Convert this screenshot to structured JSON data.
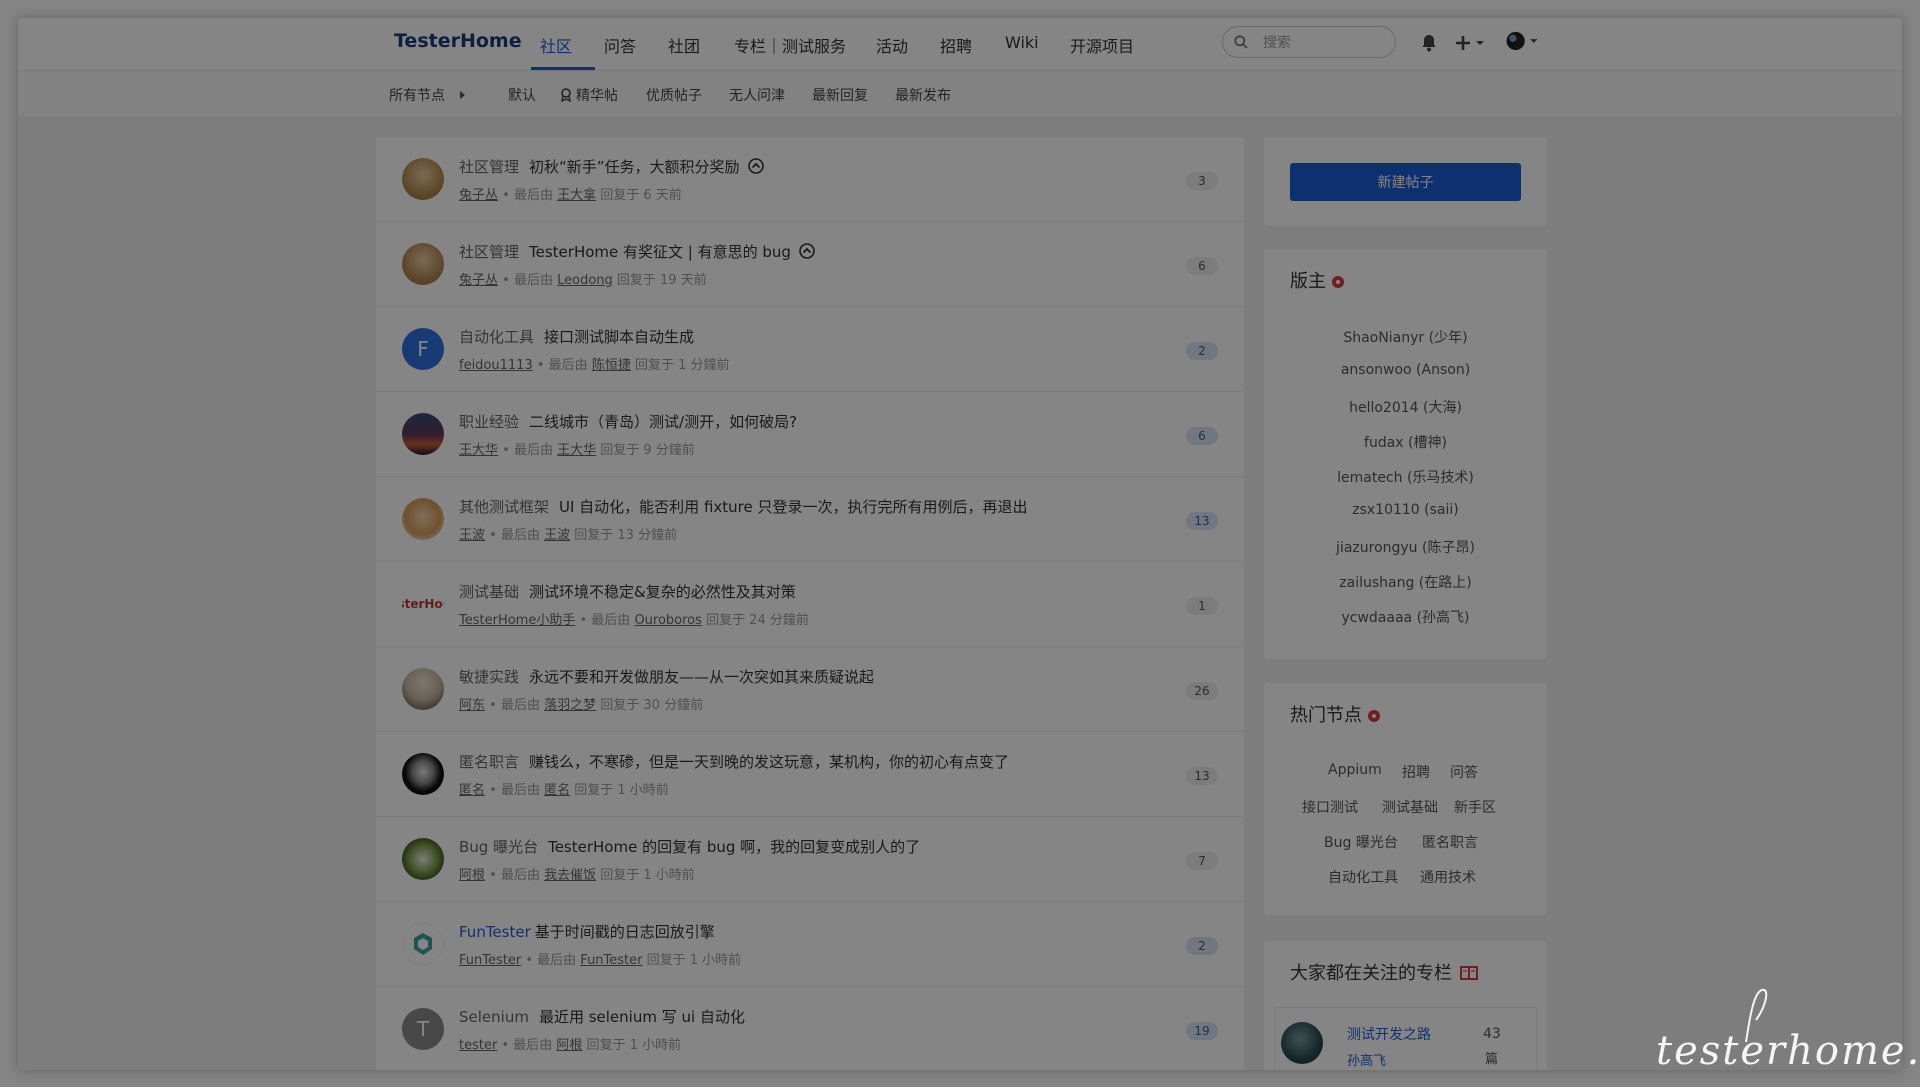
{
  "navbar": {
    "brand": "TesterHome",
    "links": [
      "社区",
      "问答",
      "社团",
      "专栏｜测试服务",
      "活动",
      "招聘",
      "Wiki",
      "开源项目"
    ],
    "search_placeholder": "搜索"
  },
  "subnav": {
    "all_nodes": "所有节点",
    "filters": [
      "默认",
      "精华帖",
      "优质帖子",
      "无人问津",
      "最新回复",
      "最新发布"
    ]
  },
  "topics": [
    {
      "node": "社区管理",
      "title": "初秋“新手”任务，大额积分奖励",
      "author": "兔子丛",
      "last_by_label": "最后由",
      "last_by": "王大拿",
      "time": "回复于 6 天前",
      "replies": "3",
      "pinned": true
    },
    {
      "node": "社区管理",
      "title": "TesterHome 有奖征文 | 有意思的 bug",
      "author": "兔子丛",
      "last_by_label": "最后由",
      "last_by": "Leodong",
      "time": "回复于 19 天前",
      "replies": "6",
      "pinned": true
    },
    {
      "node": "自动化工具",
      "title": "接口测试脚本自动生成",
      "author": "feidou1113",
      "last_by_label": "最后由",
      "last_by": "陈恒捷",
      "time": "回复于 1 分鐘前",
      "replies": "2",
      "avatar_letter": "F"
    },
    {
      "node": "职业经验",
      "title": "二线城市（青岛）测试/测开，如何破局?",
      "author": "王大华",
      "last_by_label": "最后由",
      "last_by": "王大华",
      "time": "回复于 9 分鐘前",
      "replies": "6"
    },
    {
      "node": "其他测试框架",
      "title": "UI 自动化，能否利用 fixture 只登录一次，执行完所有用例后，再退出",
      "author": "王波",
      "last_by_label": "最后由",
      "last_by": "王波",
      "time": "回复于 13 分鐘前",
      "replies": "13"
    },
    {
      "node": "测试基础",
      "title": "测试环境不稳定&复杂的必然性及其对策",
      "author": "TesterHome小助手",
      "last_by_label": "最后由",
      "last_by": "Ouroboros",
      "time": "回复于 24 分鐘前",
      "replies": "1",
      "avatar_text": "sterHor"
    },
    {
      "node": "敏捷实践",
      "title": "永远不要和开发做朋友——从一次突如其来质疑说起",
      "author": "阿东",
      "last_by_label": "最后由",
      "last_by": "落羽之梦",
      "time": "回复于 30 分鐘前",
      "replies": "26"
    },
    {
      "node": "匿名职言",
      "title": "赚钱么，不寒碜，但是一天到晚的发这玩意，某机构，你的初心有点变了",
      "author": "匿名",
      "last_by_label": "最后由",
      "last_by": "匿名",
      "time": "回复于 1 小時前",
      "replies": "13"
    },
    {
      "node": "Bug 曝光台",
      "title": "TesterHome 的回复有 bug 啊，我的回复变成别人的了",
      "author": "阿根",
      "last_by_label": "最后由",
      "last_by": "我去催饭",
      "time": "回复于 1 小時前",
      "replies": "7"
    },
    {
      "node": "FunTester",
      "title": "基于时间戳的日志回放引擎",
      "author": "FunTester",
      "last_by_label": "最后由",
      "last_by": "FunTester",
      "time": "回复于 1 小時前",
      "replies": "2"
    },
    {
      "node": "Selenium",
      "title": "最近用 selenium 写 ui 自动化",
      "author": "tester",
      "last_by_label": "最后由",
      "last_by": "阿根",
      "time": "回复于 1 小時前",
      "replies": "19",
      "avatar_letter": "T"
    }
  ],
  "sidebar": {
    "new_post": "新建帖子",
    "moderators_title": "版主",
    "moderators": [
      "ShaoNianyr (少年)",
      "ansonwoo (Anson)",
      "hello2014 (大海)",
      "fudax (槽神)",
      "lematech (乐马技术)",
      "zsx10110 (saii)",
      "jiazurongyu (陈子昂)",
      "zailushang (在路上)",
      "ycwdaaaa (孙高飞)"
    ],
    "hot_nodes_title": "热门节点",
    "hot_nodes": [
      [
        "Appium",
        "招聘",
        "问答"
      ],
      [
        "接口测试",
        "测试基础",
        "新手区"
      ],
      [
        "Bug 曝光台",
        "匿名职言"
      ],
      [
        "自动化工具",
        "通用技术"
      ]
    ],
    "columns_title": "大家都在关注的专栏",
    "column": {
      "title": "测试开发之路",
      "author": "孙高飞",
      "count": "43",
      "unit": "篇"
    }
  },
  "watermark": "testerhome.com",
  "colors": {
    "accent": "#1a5fd6",
    "brand": "#1a3d7c",
    "badge": "#d83a3a"
  }
}
